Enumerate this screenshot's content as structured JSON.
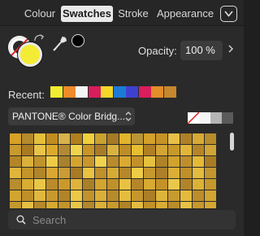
{
  "tabs": [
    {
      "label": "Colour",
      "active": false
    },
    {
      "label": "Swatches",
      "active": true
    },
    {
      "label": "Stroke",
      "active": false
    },
    {
      "label": "Appearance",
      "active": false
    }
  ],
  "colour_well": {
    "fill_color": "#f4ec34",
    "stroke_color": "none",
    "picked_color": "#000000"
  },
  "opacity": {
    "label": "Opacity:",
    "value": "100 %"
  },
  "recent": {
    "label": "Recent:",
    "swatches": [
      "#f2ec33",
      "#ef8b2a",
      "#f5f5f5",
      "#d81e5b",
      "#f5d72a",
      "#1c7bd6",
      "#3f3fd0",
      "#d81e5b",
      "#e38c2a",
      "#c6872d"
    ]
  },
  "palette": {
    "selected": "PANTONE® Color Bridg..."
  },
  "quick_swatches": [
    "none",
    "#f5f5f5",
    "#b5b5b5",
    "#5a5a5a"
  ],
  "swatch_grid": {
    "colors": [
      "#d6a126",
      "#b58a2c",
      "#e5c03a",
      "#c28c22",
      "#d7b34a",
      "#b17f1c",
      "#f0cf3b",
      "#caa12f",
      "#a57a24",
      "#e1b42c",
      "#b99535",
      "#d4a12a",
      "#c59426",
      "#e8c046",
      "#ae8128",
      "#d8a935",
      "#b88c2a",
      "#c99a2e",
      "#a87a24",
      "#e9c44b",
      "#dcaa2b",
      "#b38933",
      "#f1d34b",
      "#c79526",
      "#a87c26",
      "#d9b23d",
      "#bf8d27",
      "#e7bd32",
      "#b08024",
      "#d3a431",
      "#c89929",
      "#e1b53a",
      "#b68526",
      "#d0a535",
      "#b48628",
      "#dbb03a",
      "#c0922a",
      "#eccb45",
      "#a9812c",
      "#d5a42e",
      "#c8962b",
      "#f0d24c",
      "#b98b2d",
      "#daa92f",
      "#c39129",
      "#e6c13f",
      "#b08327",
      "#d1a22c",
      "#bd8e2b",
      "#e4b938",
      "#a97c24",
      "#e0b53c",
      "#c49629",
      "#b1852a",
      "#dba730",
      "#c99d35",
      "#a87b24",
      "#e9c240",
      "#c0902a",
      "#d6ab35",
      "#b7872a",
      "#efcc45",
      "#c7982c",
      "#ad8028",
      "#dbae35",
      "#bf8f29",
      "#e3bb3e",
      "#c3962f",
      "#b78d2e",
      "#d9ac33",
      "#eac646",
      "#ba8b2b",
      "#c9992a",
      "#dfb43c",
      "#a98026",
      "#d2a52f",
      "#c09029",
      "#e8c142",
      "#b4862a",
      "#d7aa32",
      "#c49328",
      "#eac849",
      "#b0842b",
      "#ddb136",
      "#c5982c",
      "#d3a52f",
      "#bf902a",
      "#e1b83e",
      "#c8992d",
      "#b08428",
      "#edc845",
      "#c1922b",
      "#d9af38",
      "#b78a2a",
      "#e5bd3d",
      "#c5972c",
      "#ab7f27",
      "#dfb539",
      "#c69a2f",
      "#e3ba3c",
      "#bc8d2a",
      "#d2a430",
      "#c4982e",
      "#e6c043",
      "#b68a2c",
      "#d6a931",
      "#c39429",
      "#e9c648",
      "#b3882c",
      "#dbb036",
      "#c9992c",
      "#b08327",
      "#e4bc3f",
      "#c19229",
      "#d8ac34",
      "#bb8c2a",
      "#e7c244",
      "#c6982d",
      "#d5a830"
    ]
  },
  "search": {
    "placeholder": "Search"
  }
}
